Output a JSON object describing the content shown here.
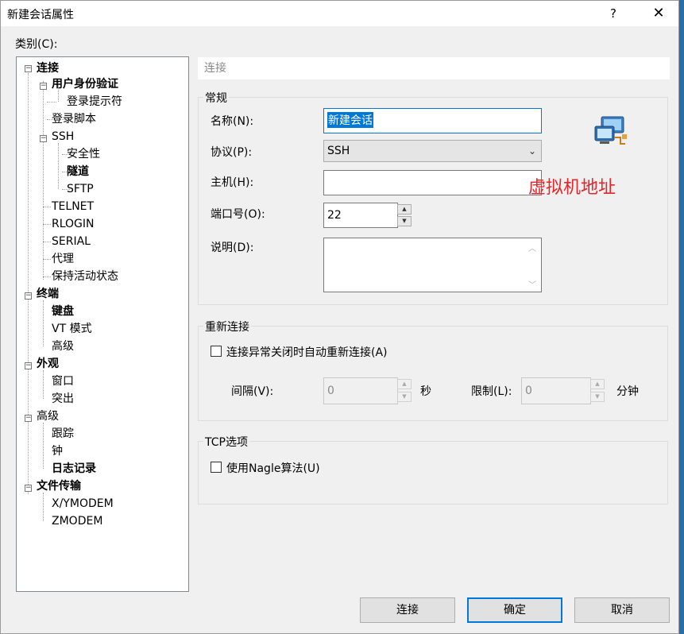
{
  "window": {
    "title": "新建会话属性",
    "help": "?",
    "close": "✕"
  },
  "category_label": "类别(C):",
  "tree": [
    {
      "label": "连接",
      "bold": true
    },
    {
      "label": "用户身份验证",
      "bold": true
    },
    {
      "label": "登录提示符",
      "bold": false
    },
    {
      "label": "登录脚本",
      "bold": false
    },
    {
      "label": "SSH",
      "bold": false
    },
    {
      "label": "安全性",
      "bold": false
    },
    {
      "label": "隧道",
      "bold": true
    },
    {
      "label": "SFTP",
      "bold": false
    },
    {
      "label": "TELNET",
      "bold": false
    },
    {
      "label": "RLOGIN",
      "bold": false
    },
    {
      "label": "SERIAL",
      "bold": false
    },
    {
      "label": "代理",
      "bold": false
    },
    {
      "label": "保持活动状态",
      "bold": false
    },
    {
      "label": "终端",
      "bold": true
    },
    {
      "label": "键盘",
      "bold": true
    },
    {
      "label": "VT 模式",
      "bold": false
    },
    {
      "label": "高级",
      "bold": false
    },
    {
      "label": "外观",
      "bold": true
    },
    {
      "label": "窗口",
      "bold": false
    },
    {
      "label": "突出",
      "bold": false
    },
    {
      "label": "高级",
      "bold": false
    },
    {
      "label": "跟踪",
      "bold": false
    },
    {
      "label": "钟",
      "bold": false
    },
    {
      "label": "日志记录",
      "bold": true
    },
    {
      "label": "文件传输",
      "bold": true
    },
    {
      "label": "X/YMODEM",
      "bold": false
    },
    {
      "label": "ZMODEM",
      "bold": false
    }
  ],
  "section_header": "连接",
  "general": {
    "title": "常规",
    "name_label": "名称(N):",
    "name_value": "新建会话",
    "protocol_label": "协议(P):",
    "protocol_value": "SSH",
    "host_label": "主机(H):",
    "host_value": "",
    "port_label": "端口号(O):",
    "port_value": "22",
    "desc_label": "说明(D):",
    "desc_value": ""
  },
  "annotation": "虚拟机地址",
  "reconnect": {
    "title": "重新连接",
    "auto_label": "连接异常关闭时自动重新连接(A)",
    "auto_checked": false,
    "interval_label": "间隔(V):",
    "interval_value": "0",
    "interval_unit": "秒",
    "limit_label": "限制(L):",
    "limit_value": "0",
    "limit_unit": "分钟"
  },
  "tcp": {
    "title": "TCP选项",
    "nagle_label": "使用Nagle算法(U)",
    "nagle_checked": false
  },
  "buttons": {
    "connect": "连接",
    "ok": "确定",
    "cancel": "取消"
  },
  "colors": {
    "accent": "#0078d7",
    "annotation": "#e5252a"
  }
}
